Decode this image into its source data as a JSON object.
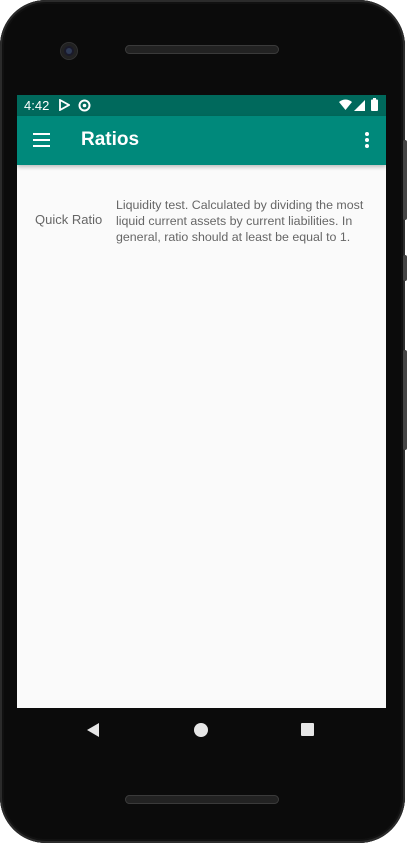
{
  "status_bar": {
    "time": "4:42",
    "left_icons": [
      "play-store-icon",
      "data-saver-icon"
    ],
    "right_icons": [
      "wifi-icon",
      "signal-icon",
      "battery-icon"
    ]
  },
  "app_bar": {
    "title": "Ratios",
    "color": "#00897b",
    "status_color": "#00695c",
    "menu_icon": "hamburger-menu-icon",
    "overflow_icon": "more-vert-icon"
  },
  "ratios": [
    {
      "name": "Quick Ratio",
      "description": "Liquidity test. Calculated by dividing the most liquid current assets by current liabilities. In general, ratio should at least be equal to 1."
    }
  ],
  "nav_bar": {
    "icons": [
      "back-icon",
      "home-icon",
      "recents-icon"
    ]
  }
}
